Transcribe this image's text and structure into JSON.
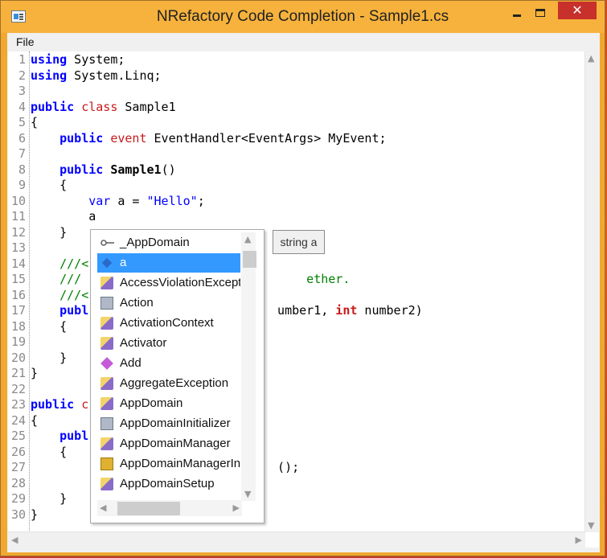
{
  "window": {
    "title": "NRefactory Code Completion - Sample1.cs",
    "close_glyph": "✕"
  },
  "menu": {
    "file": "File"
  },
  "editor": {
    "lines": [
      {
        "n": "1",
        "html": "<span class='kw'>using</span> System;"
      },
      {
        "n": "2",
        "html": "<span class='kw'>using</span> System.Linq;"
      },
      {
        "n": "3",
        "html": ""
      },
      {
        "n": "4",
        "html": "<span class='kw'>public</span> <span class='mod'>class</span> Sample1"
      },
      {
        "n": "5",
        "html": "{"
      },
      {
        "n": "6",
        "html": "    <span class='kw'>public</span> <span class='mod'>event</span> EventHandler&lt;EventArgs&gt; MyEvent;"
      },
      {
        "n": "7",
        "html": ""
      },
      {
        "n": "8",
        "html": "    <span class='kw'>public</span> <span class='bold'>Sample1</span>()"
      },
      {
        "n": "9",
        "html": "    {"
      },
      {
        "n": "10",
        "html": "        <span class='str'>var</span> a = <span class='str'>\"Hello\"</span>;"
      },
      {
        "n": "11",
        "html": "        a"
      },
      {
        "n": "12",
        "html": "    }"
      },
      {
        "n": "13",
        "html": ""
      },
      {
        "n": "14",
        "html": "    <span class='cmt'>///&lt;</span>"
      },
      {
        "n": "15",
        "html": "    <span class='cmt'>///                               ether.</span>"
      },
      {
        "n": "16",
        "html": "    <span class='cmt'>///&lt;</span>"
      },
      {
        "n": "17",
        "html": "    <span class='kw'>publ</span>                          umber1, <span class='red-bold'>int</span> number2)"
      },
      {
        "n": "18",
        "html": "    {"
      },
      {
        "n": "19",
        "html": ""
      },
      {
        "n": "20",
        "html": "    }"
      },
      {
        "n": "21",
        "html": "}"
      },
      {
        "n": "22",
        "html": ""
      },
      {
        "n": "23",
        "html": "<span class='kw'>public</span> <span class='mod'>c</span>"
      },
      {
        "n": "24",
        "html": "{"
      },
      {
        "n": "25",
        "html": "    <span class='kw'>publ</span>"
      },
      {
        "n": "26",
        "html": "    {"
      },
      {
        "n": "27",
        "html": "                                  ();"
      },
      {
        "n": "28",
        "html": ""
      },
      {
        "n": "29",
        "html": "    }"
      },
      {
        "n": "30",
        "html": "}"
      }
    ]
  },
  "completion": {
    "items": [
      {
        "label": "_AppDomain",
        "icon": "interface-icon",
        "kind": "i-interface"
      },
      {
        "label": "a",
        "icon": "local-variable-icon",
        "kind": "i-local",
        "selected": true
      },
      {
        "label": "AccessViolationExcepti",
        "icon": "class-icon",
        "kind": "i-class"
      },
      {
        "label": "Action",
        "icon": "delegate-icon",
        "kind": "i-struct"
      },
      {
        "label": "ActivationContext",
        "icon": "class-icon",
        "kind": "i-class"
      },
      {
        "label": "Activator",
        "icon": "class-icon",
        "kind": "i-class"
      },
      {
        "label": "Add",
        "icon": "method-icon",
        "kind": "i-method"
      },
      {
        "label": "AggregateException",
        "icon": "class-icon",
        "kind": "i-class"
      },
      {
        "label": "AppDomain",
        "icon": "class-icon",
        "kind": "i-class"
      },
      {
        "label": "AppDomainInitializer",
        "icon": "delegate-icon",
        "kind": "i-struct"
      },
      {
        "label": "AppDomainManager",
        "icon": "class-icon",
        "kind": "i-class"
      },
      {
        "label": "AppDomainManagerIn",
        "icon": "enum-icon",
        "kind": "i-enum"
      },
      {
        "label": "AppDomainSetup",
        "icon": "class-icon",
        "kind": "i-class"
      }
    ]
  },
  "tooltip": {
    "text": "string a"
  }
}
